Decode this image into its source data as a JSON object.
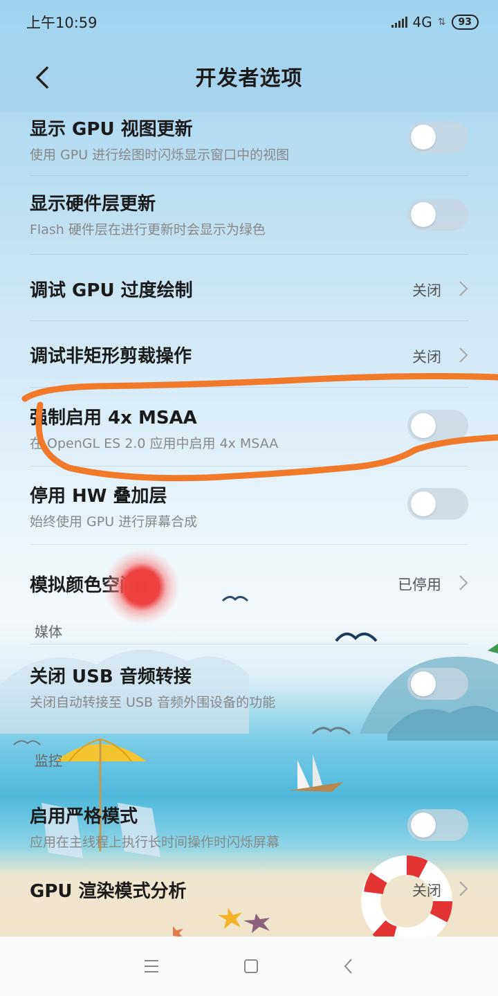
{
  "status_bar": {
    "time": "上午10:59",
    "network": "4G",
    "battery": "93"
  },
  "header": {
    "title": "开发者选项",
    "back_icon": "chevron-left-icon"
  },
  "settings": [
    {
      "label": "显示 GPU 视图更新",
      "sub": "使用 GPU 进行绘图时闪烁显示窗口中的视图",
      "control": "toggle",
      "on": false
    },
    {
      "label": "显示硬件层更新",
      "sub": "Flash 硬件层在进行更新时会显示为绿色",
      "control": "toggle",
      "on": false
    },
    {
      "label": "调试 GPU 过度绘制",
      "value": "关闭",
      "control": "chevron"
    },
    {
      "label": "调试非矩形剪裁操作",
      "value": "关闭",
      "control": "chevron"
    },
    {
      "label": "强制启用 4x MSAA",
      "sub": "在 OpenGL ES 2.0 应用中启用 4x MSAA",
      "control": "toggle",
      "on": false
    },
    {
      "label": "停用 HW 叠加层",
      "sub": "始终使用 GPU 进行屏幕合成",
      "control": "toggle",
      "on": false
    },
    {
      "label": "模拟颜色空间",
      "value": "已停用",
      "control": "chevron"
    }
  ],
  "section_media": "媒体",
  "media_settings": [
    {
      "label": "关闭 USB 音频转接",
      "sub": "关闭自动转接至 USB 音频外围设备的功能",
      "control": "toggle",
      "on": false
    }
  ],
  "section_monitor": "监控",
  "monitor_settings": [
    {
      "label": "启用严格模式",
      "sub": "应用在主线程上执行长时间操作时闪烁屏幕",
      "control": "toggle",
      "on": false
    },
    {
      "label": "GPU 渲染模式分析",
      "value": "关闭",
      "control": "chevron"
    }
  ],
  "nav_bar": {
    "menu_icon": "menu-icon",
    "home_icon": "home-square-icon",
    "back_icon": "back-triangle-icon"
  },
  "colors": {
    "annotation_stroke": "#f07a2a",
    "touch_indicator": "#ee4343",
    "header_bg": "#a6d3ee"
  }
}
